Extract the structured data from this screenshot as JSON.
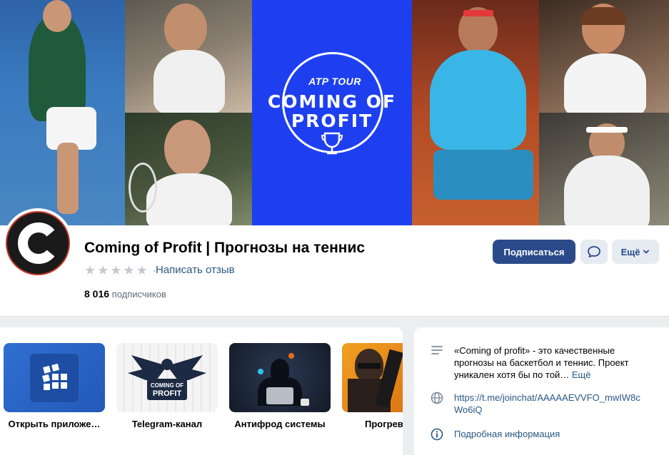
{
  "cover": {
    "atp_logo": "ATP TOUR",
    "title_line1": "COMING OF",
    "title_line2": "PROFIT"
  },
  "community": {
    "name": "Coming of Profit | Прогнозы на теннис",
    "review_link": "Написать отзыв",
    "review_dot": "·",
    "subscribers_count": "8 016",
    "subscribers_label": "подписчиков",
    "rating_stars": 0
  },
  "actions": {
    "subscribe_label": "Подписаться",
    "more_label": "Ещё"
  },
  "apps": [
    {
      "label": "Открыть приложе…",
      "icon": "app-grid-icon",
      "bg": "#2d66c9"
    },
    {
      "label": "Telegram-канал",
      "icon": "eagle-logo",
      "bg": "#f2f2f2",
      "thumb_text_1": "COMING OF",
      "thumb_text_2": "PROFIT"
    },
    {
      "label": "Антифрод системы",
      "icon": "hacker-laptop",
      "bg": "#1c2331"
    },
    {
      "label": "Прогрев",
      "icon": "hacker-poster",
      "bg": "#e08a1c"
    }
  ],
  "info": {
    "description": "«Coming of profit» - это качественные прогнозы на баскетбол и теннис. Проект уникален хотя бы по той…",
    "description_more": "Ещё",
    "link": "https://t.me/joinchat/AAAAAEVVFO_mwIW8cWo6iQ",
    "details": "Подробная информация"
  },
  "colors": {
    "primary_button": "#2a4a8a",
    "link": "#2a5885",
    "page_bg": "#edeef0"
  }
}
